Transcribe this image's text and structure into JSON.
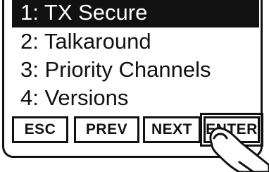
{
  "menu": {
    "items": [
      {
        "label": "1: TX Secure",
        "selected": true
      },
      {
        "label": "2: Talkaround",
        "selected": false
      },
      {
        "label": "3: Priority Channels",
        "selected": false
      },
      {
        "label": "4: Versions",
        "selected": false
      }
    ]
  },
  "softkeys": {
    "esc": "ESC",
    "prev": "PREV",
    "next": "NEXT",
    "enter": "ENTER"
  },
  "icons": {
    "pointer": "finger-press-icon"
  },
  "colors": {
    "foreground": "#111111",
    "background": "#ffffff"
  }
}
